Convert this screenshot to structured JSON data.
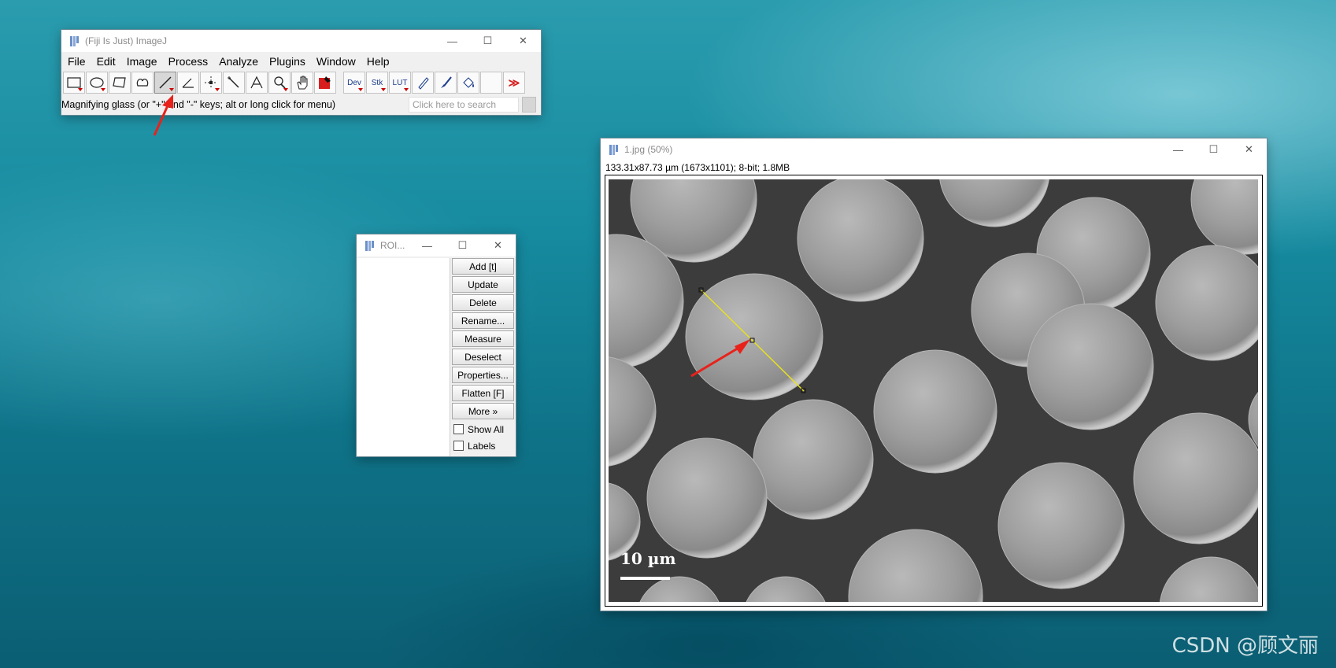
{
  "imagej": {
    "title": "(Fiji Is Just) ImageJ",
    "menu": [
      "File",
      "Edit",
      "Image",
      "Process",
      "Analyze",
      "Plugins",
      "Window",
      "Help"
    ],
    "tools_text": {
      "dev": "Dev",
      "stk": "Stk",
      "lut": "LUT",
      "more": "≫"
    },
    "status": "Magnifying glass (or \"+\" and \"-\" keys; alt or long click for menu)",
    "search_placeholder": "Click here to search"
  },
  "roi": {
    "title": "ROI...",
    "buttons": [
      "Add [t]",
      "Update",
      "Delete",
      "Rename...",
      "Measure",
      "Deselect",
      "Properties...",
      "Flatten [F]",
      "More »"
    ],
    "checkboxes": [
      "Show All",
      "Labels"
    ]
  },
  "image_window": {
    "title": "1.jpg (50%)",
    "info": "133.31x87.73 µm (1673x1101); 8-bit; 1.8MB",
    "scalebar_label": "10 µm",
    "line_color": "#e8e020"
  },
  "watermark": "CSDN @顾文丽",
  "colors": {
    "accent_red": "#e8221b",
    "selection_line": "#e8e020"
  }
}
